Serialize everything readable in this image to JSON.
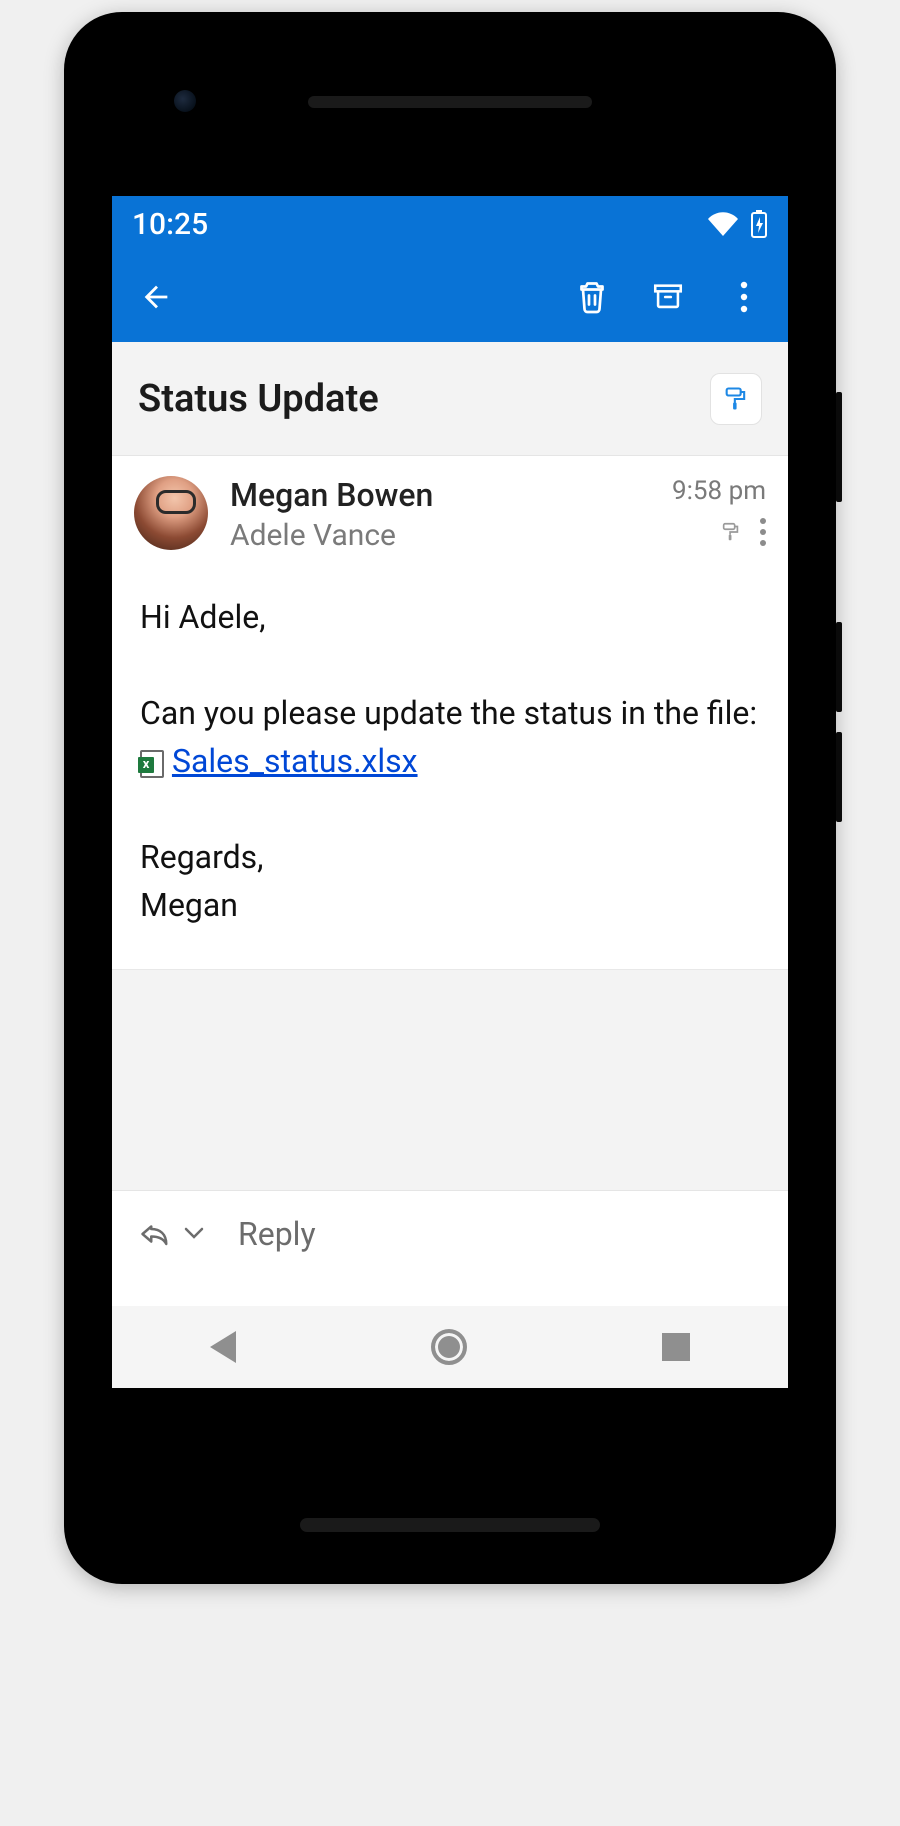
{
  "statusbar": {
    "time": "10:25"
  },
  "appbar": {
    "back_icon": "arrow-left",
    "delete_icon": "trash",
    "archive_icon": "archive",
    "overflow_icon": "more-vert"
  },
  "subject": {
    "title": "Status Update",
    "paint_icon": "paint-roller"
  },
  "message": {
    "sender": "Megan Bowen",
    "recipient": "Adele Vance",
    "time": "9:58 pm",
    "body": {
      "greeting": "Hi Adele,",
      "line1_pre": "Can you please update the status in the file: ",
      "file_name": "Sales_status.xlsx",
      "closing1": "Regards,",
      "closing2": "Megan"
    }
  },
  "reply": {
    "label": "Reply"
  }
}
